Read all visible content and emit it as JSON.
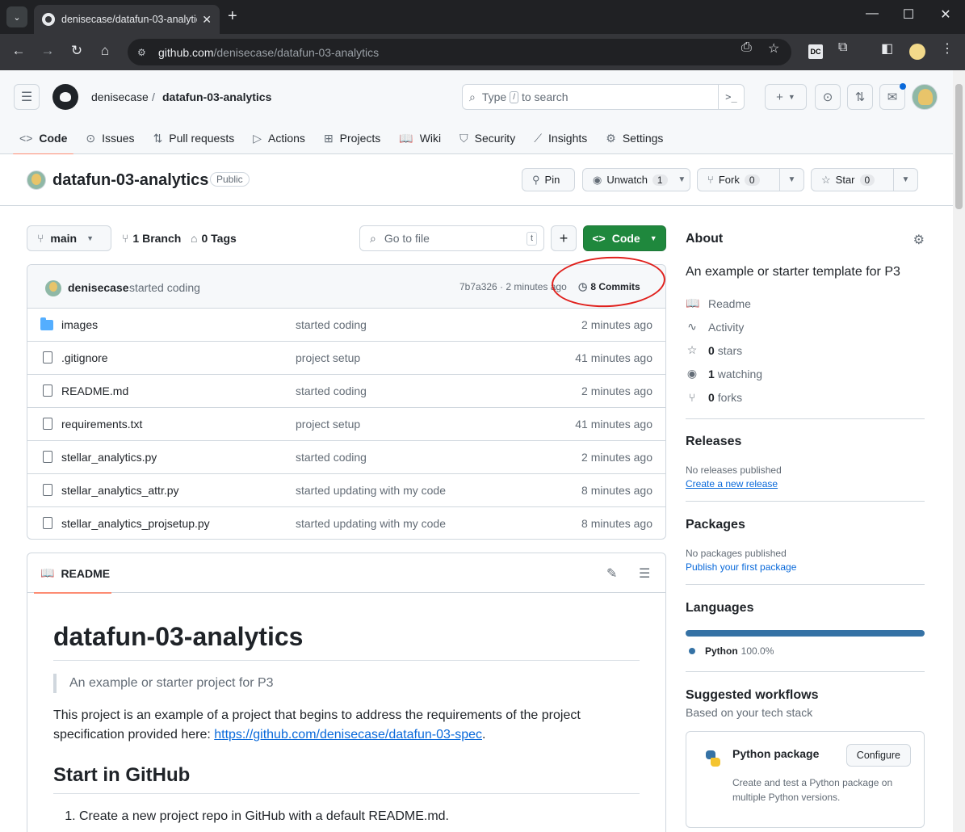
{
  "browser": {
    "tab_title": "denisecase/datafun-03-analytic",
    "url_domain": "github.com",
    "url_path": "/denisecase/datafun-03-analytics"
  },
  "header": {
    "owner": "denisecase",
    "separator": "/",
    "repo": "datafun-03-analytics",
    "search_placeholder_1": "Type",
    "search_slash": "/",
    "search_placeholder_2": "to search"
  },
  "repo_nav": [
    {
      "icon": "code-icon",
      "glyph": "<>",
      "label": "Code"
    },
    {
      "icon": "issues-icon",
      "glyph": "⊙",
      "label": "Issues"
    },
    {
      "icon": "pull-request-icon",
      "glyph": "⇅",
      "label": "Pull requests"
    },
    {
      "icon": "actions-icon",
      "glyph": "▷",
      "label": "Actions"
    },
    {
      "icon": "projects-icon",
      "glyph": "⊞",
      "label": "Projects"
    },
    {
      "icon": "wiki-icon",
      "glyph": "📖",
      "label": "Wiki"
    },
    {
      "icon": "security-icon",
      "glyph": "⛉",
      "label": "Security"
    },
    {
      "icon": "insights-icon",
      "glyph": "⟋",
      "label": "Insights"
    },
    {
      "icon": "settings-icon",
      "glyph": "⚙",
      "label": "Settings"
    }
  ],
  "repo_title": {
    "name": "datafun-03-analytics",
    "visibility": "Public",
    "pin": "Pin",
    "unwatch": "Unwatch",
    "watch_count": "1",
    "fork": "Fork",
    "fork_count": "0",
    "star": "Star",
    "star_count": "0"
  },
  "branch_bar": {
    "branch": "main",
    "branches": "1 Branch",
    "tags": "0 Tags",
    "goto_placeholder": "Go to file",
    "goto_key": "t",
    "add": "+",
    "code": "Code"
  },
  "latest_commit": {
    "author": "denisecase",
    "message": "started coding",
    "meta": "7b7a326 · 2 minutes ago",
    "commits": "8 Commits"
  },
  "files": [
    {
      "type": "folder",
      "name": "images",
      "message": "started coding",
      "age": "2 minutes ago"
    },
    {
      "type": "file",
      "name": ".gitignore",
      "message": "project setup",
      "age": "41 minutes ago"
    },
    {
      "type": "file",
      "name": "README.md",
      "message": "started coding",
      "age": "2 minutes ago"
    },
    {
      "type": "file",
      "name": "requirements.txt",
      "message": "project setup",
      "age": "41 minutes ago"
    },
    {
      "type": "file",
      "name": "stellar_analytics.py",
      "message": "started coding",
      "age": "2 minutes ago"
    },
    {
      "type": "file",
      "name": "stellar_analytics_attr.py",
      "message": "started updating with my code",
      "age": "8 minutes ago"
    },
    {
      "type": "file",
      "name": "stellar_analytics_projsetup.py",
      "message": "started updating with my code",
      "age": "8 minutes ago"
    }
  ],
  "readme": {
    "tab": "README",
    "h1": "datafun-03-analytics",
    "quote": "An example or starter project for P3",
    "p1_text": "This project is an example of a project that begins to address the requirements of the project specification provided here: ",
    "p1_link": "https://github.com/denisecase/datafun-03-spec",
    "p1_end": ".",
    "h2": "Start in GitHub",
    "li1": "Create a new project repo in GitHub with a default README.md."
  },
  "sidebar": {
    "about_title": "About",
    "about_desc": "An example or starter template for P3",
    "readme": "Readme",
    "activity": "Activity",
    "stars_count": "0",
    "stars_label": "stars",
    "watching_count": "1",
    "watching_label": "watching",
    "forks_count": "0",
    "forks_label": "forks",
    "releases_title": "Releases",
    "releases_none": "No releases published",
    "releases_link": "Create a new release",
    "packages_title": "Packages",
    "packages_none": "No packages published",
    "packages_link": "Publish your first package",
    "languages_title": "Languages",
    "lang_name": "Python",
    "lang_pct": "100.0%",
    "lang_fraction": 1.0,
    "lang_color": "#3572A5",
    "workflows_title": "Suggested workflows",
    "workflows_sub": "Based on your tech stack",
    "wf_title": "Python package",
    "wf_button": "Configure",
    "wf_desc": "Create and test a Python package on multiple Python versions."
  }
}
